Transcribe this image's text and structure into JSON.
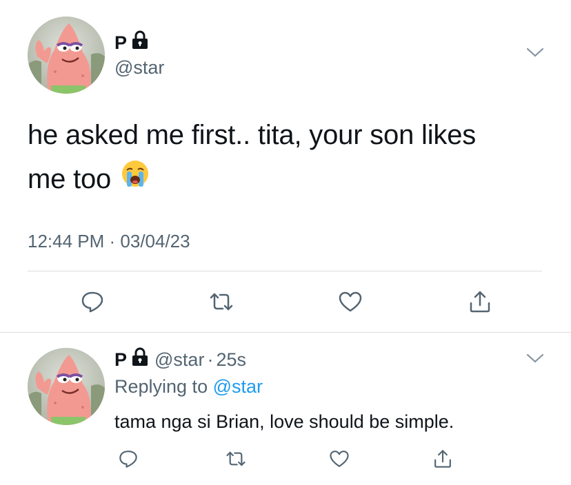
{
  "tweet": {
    "author_name": "P",
    "author_handle": "@star",
    "text_line1": "he asked me first.. tita, your son likes",
    "text_line2": "me too",
    "emoji": "😭",
    "timestamp": "12:44 PM · 03/04/23",
    "icons": {
      "reply": "reply-icon",
      "retweet": "retweet-icon",
      "like": "like-icon",
      "share": "share-icon",
      "lock": "lock-icon",
      "more": "chevron-down-icon"
    }
  },
  "reply": {
    "author_name": "P",
    "author_handle": "@star",
    "separator": "·",
    "time": "25s",
    "replying_prefix": "Replying to",
    "replying_to": "@star",
    "text": "tama nga si Brian, love should be simple."
  },
  "colors": {
    "text": "#0f1419",
    "secondary": "#536471",
    "link": "#1d9bf0",
    "divider": "#d9dde1"
  }
}
